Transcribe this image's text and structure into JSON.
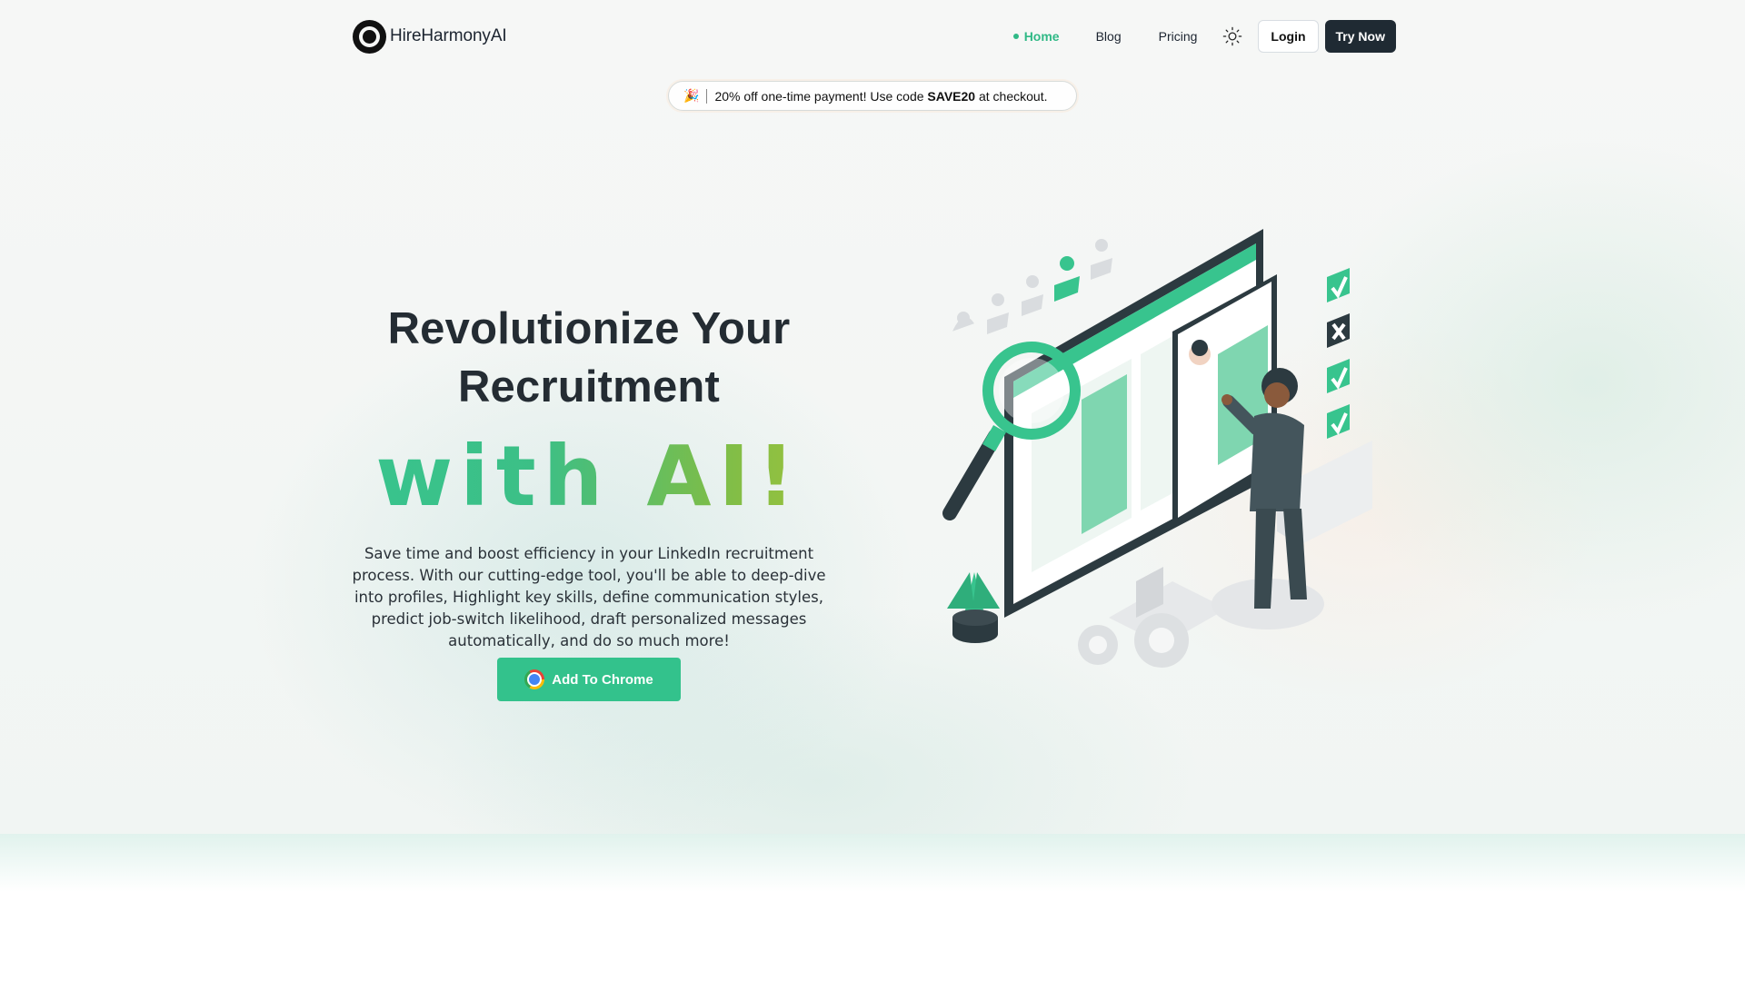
{
  "header": {
    "brand_name": "HireHarmonyAI",
    "nav": {
      "home": "Home",
      "blog": "Blog",
      "pricing": "Pricing"
    },
    "login_label": "Login",
    "try_label": "Try Now",
    "theme_toggle_icon": "sun-icon"
  },
  "promo": {
    "icon": "🎉",
    "text_before": "20% off one-time payment! Use code ",
    "code": "SAVE20",
    "text_after": " at checkout."
  },
  "hero": {
    "title_line1": "Revolutionize Your",
    "title_line2": "Recruitment",
    "highlight": "with AI!",
    "description": "Save time and boost efficiency in your LinkedIn recruitment process. With our cutting-edge tool, you'll be able to deep-dive into profiles, Highlight key skills, define communication styles, predict job-switch likelihood, draft personalized messages automatically, and do so much more!",
    "cta_label": "Add To Chrome",
    "cta_icon": "chrome-icon"
  },
  "colors": {
    "accent": "#33c28c",
    "dark": "#1f2a33",
    "highlight_gradient": [
      "#38c48e",
      "#9fc23a"
    ]
  }
}
